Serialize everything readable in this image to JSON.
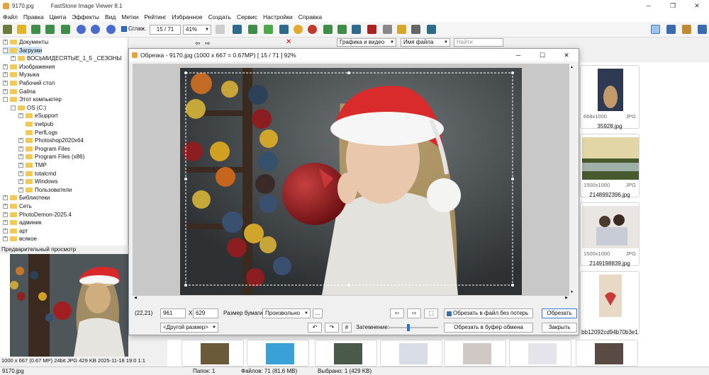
{
  "window": {
    "filename": "9170.jpg",
    "app": "FastStone Image Viewer 8.1"
  },
  "menu": [
    "Файл",
    "Правка",
    "Цвета",
    "Эффекты",
    "Вид",
    "Метки",
    "Рейтинг",
    "Избранное",
    "Создать",
    "Сервис",
    "Настройки",
    "Справка"
  ],
  "toolbar": {
    "smooth_label": "Сглаж.",
    "page": "15 / 71",
    "zoom": "41%"
  },
  "filter": {
    "type": "Графика и видео",
    "sort": "Имя файла",
    "search_placeholder": "Найти"
  },
  "tree": [
    {
      "label": "Документы",
      "level": 0,
      "exp": "+"
    },
    {
      "label": "Загрузки",
      "level": 0,
      "exp": "-",
      "selected": true
    },
    {
      "label": "ВОСЬМИДЕСЯТЫЕ_1_5 _СЕЗОНЫ",
      "level": 1,
      "exp": "+"
    },
    {
      "label": "Изображения",
      "level": 0,
      "exp": "+"
    },
    {
      "label": "Музыка",
      "level": 0,
      "exp": "+"
    },
    {
      "label": "Рабочий стол",
      "level": 0,
      "exp": "+"
    },
    {
      "label": "Galina",
      "level": 0,
      "exp": "+"
    },
    {
      "label": "Этот компьютер",
      "level": 0,
      "exp": "-"
    },
    {
      "label": "OS (C:)",
      "level": 1,
      "exp": "-"
    },
    {
      "label": "eSupport",
      "level": 2,
      "exp": "+"
    },
    {
      "label": "inetpub",
      "level": 2,
      "exp": ""
    },
    {
      "label": "PerfLogs",
      "level": 2,
      "exp": ""
    },
    {
      "label": "Photoshop2020x64",
      "level": 2,
      "exp": "+"
    },
    {
      "label": "Program Files",
      "level": 2,
      "exp": "+"
    },
    {
      "label": "Program Files (x86)",
      "level": 2,
      "exp": "+"
    },
    {
      "label": "TMP",
      "level": 2,
      "exp": "+"
    },
    {
      "label": "totalcmd",
      "level": 2,
      "exp": "+"
    },
    {
      "label": "Windows",
      "level": 2,
      "exp": "+"
    },
    {
      "label": "Пользователи",
      "level": 2,
      "exp": "+"
    },
    {
      "label": "Библиотеки",
      "level": 0,
      "exp": "+"
    },
    {
      "label": "Сеть",
      "level": 0,
      "exp": "+"
    },
    {
      "label": "PhotoDemon-2025.4",
      "level": 0,
      "exp": "+"
    },
    {
      "label": "админик",
      "level": 0,
      "exp": "+"
    },
    {
      "label": "арт",
      "level": 0,
      "exp": "+"
    },
    {
      "label": "всякое",
      "level": 0,
      "exp": "+"
    }
  ],
  "preview": {
    "label": "Предварительный просмотр",
    "info": "1000 x 667 (0.67 MP)  24bit  JPG   429 KB   2025-11-18 19:0  1:1"
  },
  "thumbs": [
    {
      "size": "668x1000",
      "ext": "JPG",
      "name": "35928.jpg"
    },
    {
      "size": "1500x1000",
      "ext": "JPG",
      "name": "2148992396.jpg"
    },
    {
      "size": "1500x1000",
      "ext": "JPG",
      "name": "2149198839.jpg"
    },
    {
      "size": "",
      "ext": "",
      "name": "bb12092cd94b70b3e1"
    }
  ],
  "status": {
    "file": "9170.jpg",
    "folders": "Папок: 1",
    "files": "Файлов: 71 (81.6 MB)",
    "selected": "Выбрано: 1 (429 KB)"
  },
  "dialog": {
    "title": "Обрезка  -  9170.jpg  (1000 x 667 = 0.67MP)  [ 15 / 71 ]   92%",
    "coords": "(22,21)",
    "width": "961",
    "x": "X",
    "height": "629",
    "paper_label": "Размер бумаги:",
    "paper_value": "Произвольно",
    "dots": "...",
    "other_size": "<Другой размер>",
    "dim_label": "Затемнение:",
    "save_lossless": "Обрезать в файл без потерь",
    "crop": "Обрезать",
    "crop_clipboard": "Обрезать в буфер обмена",
    "close": "Закрыть"
  }
}
